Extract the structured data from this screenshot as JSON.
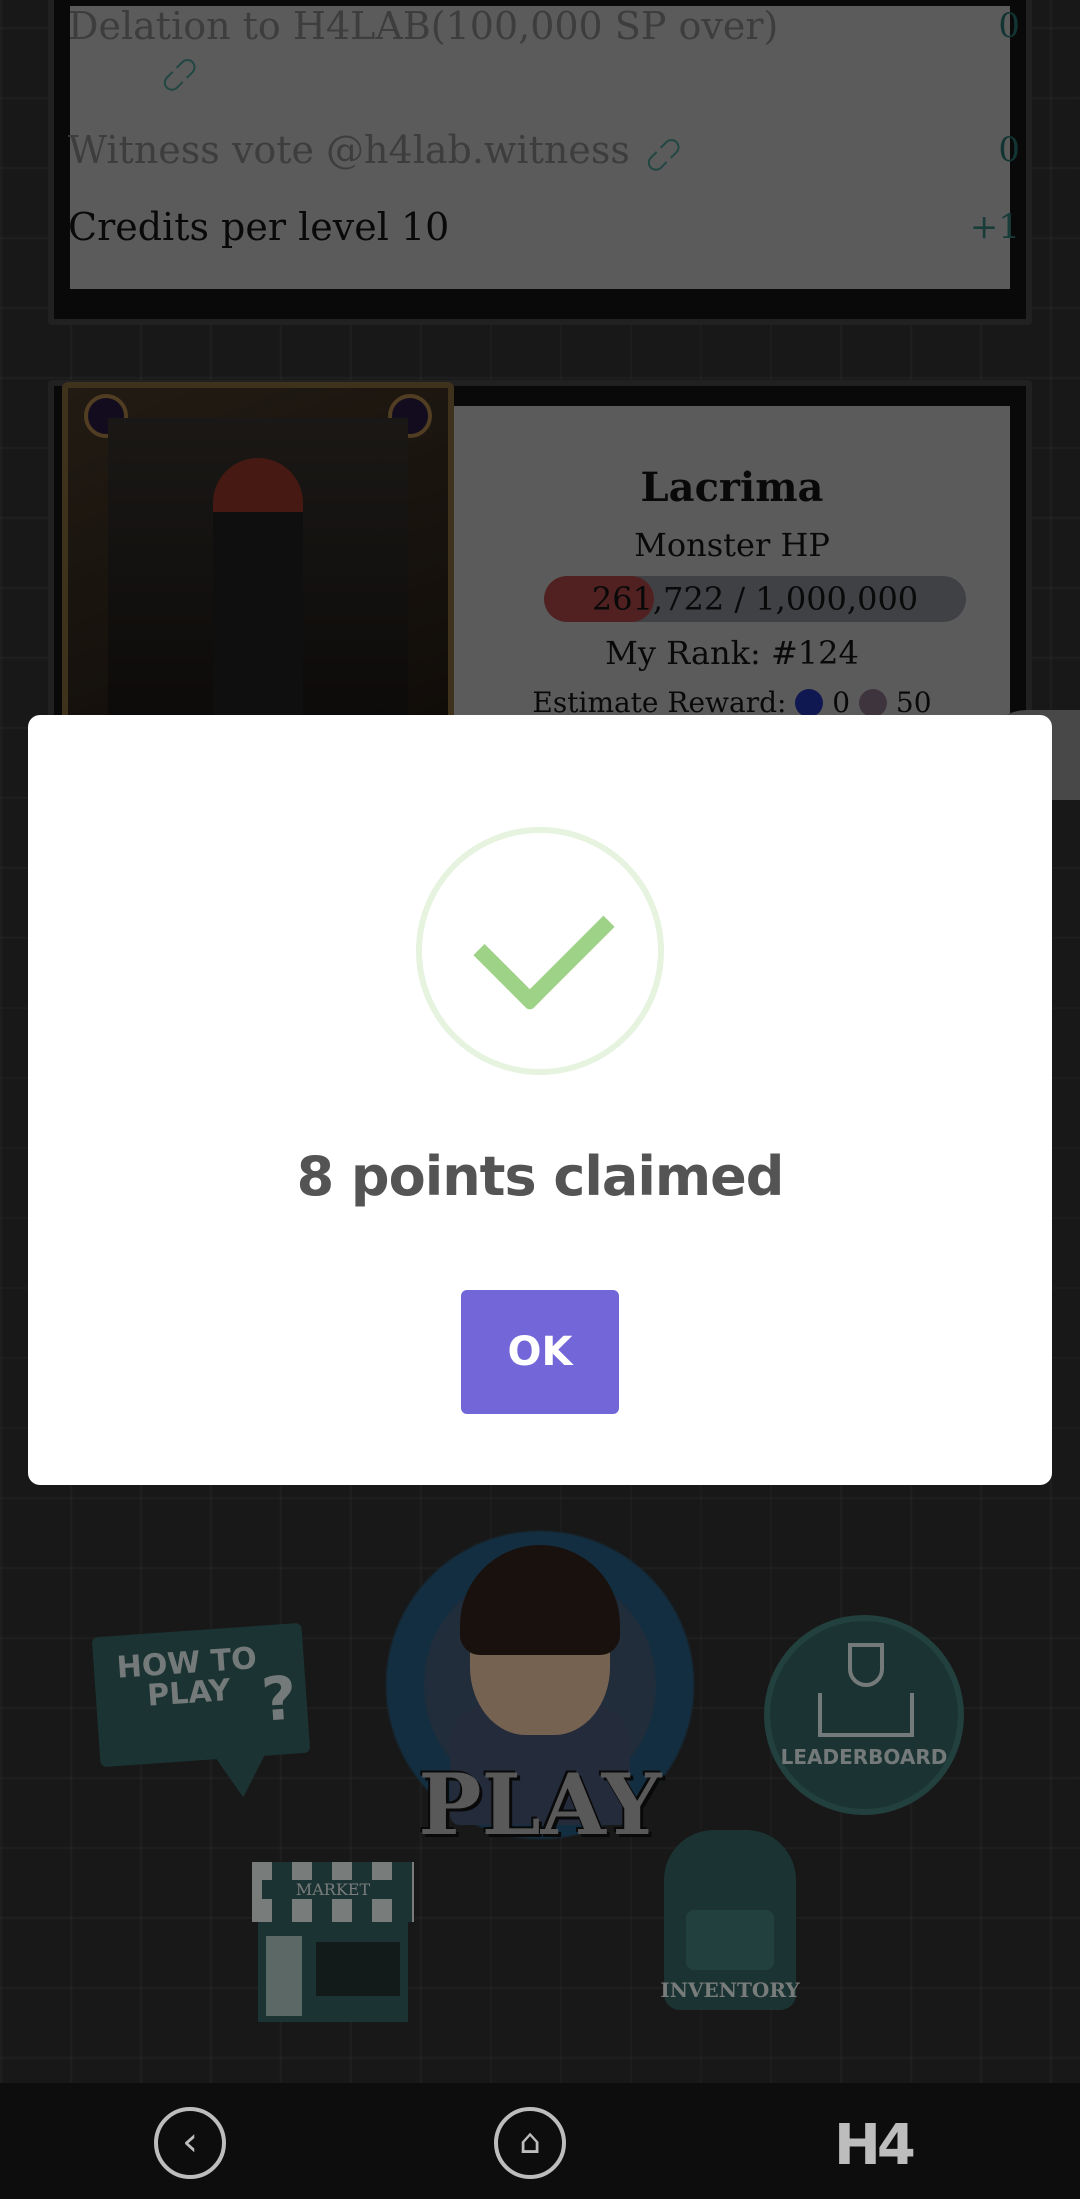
{
  "top_panel": {
    "rows": [
      {
        "label": "Delation to H4LAB(100,000 SP over)",
        "value": "0"
      },
      {
        "label": "Witness vote @h4lab.witness",
        "value": "0"
      },
      {
        "label": "Credits per level 10",
        "value": "+1"
      }
    ]
  },
  "boss": {
    "name": "Lacrima",
    "hp_label": "Monster HP",
    "hp_current": 261722,
    "hp_max": 1000000,
    "hp_text": "261,722 / 1,000,000",
    "rank_text": "My Rank: #124",
    "reward_label": "Estimate Reward:",
    "reward_steem": "0",
    "reward_monster": "50"
  },
  "menu": {
    "how_to_play": "HOW TO PLAY",
    "play": "PLAY",
    "leaderboard": "LEADERBOARD",
    "market": "MARKET",
    "inventory": "INVENTORY"
  },
  "modal": {
    "title": "8 points claimed",
    "ok_label": "OK",
    "check_color": "#9ed287",
    "button_color": "#7366d8"
  },
  "nav": {
    "back_icon": "‹",
    "home_icon": "⌂",
    "logo": "H4"
  }
}
